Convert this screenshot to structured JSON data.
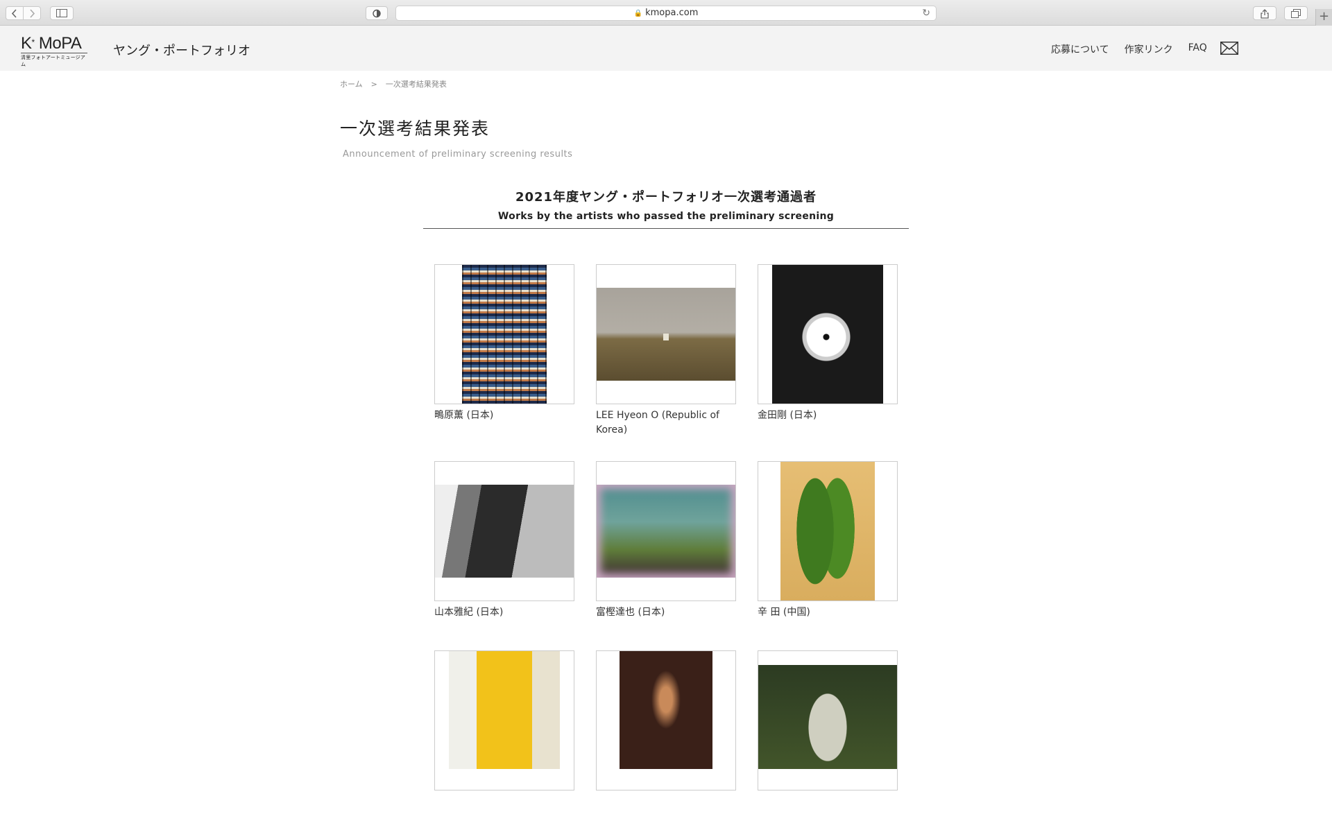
{
  "browser": {
    "url": "kmopa.com"
  },
  "header": {
    "logo_main": "K",
    "logo_sup": "*",
    "logo_rest": "MoPA",
    "logo_sub": "清里フォトアートミュージアム",
    "site_title": "ヤング・ポートフォリオ",
    "nav": [
      "応募について",
      "作家リンク",
      "FAQ"
    ]
  },
  "breadcrumb": {
    "home": "ホーム",
    "separator": ">",
    "current": "一次選考結果発表"
  },
  "page": {
    "title": "一次選考結果発表",
    "subtitle": "Announcement of preliminary screening results"
  },
  "section": {
    "title": "2021年度ヤング・ポートフォリオ一次選考通過者",
    "subtitle": "Works by the artists who passed the preliminary screening"
  },
  "works": [
    {
      "artist": "鴫原薫 (日本)"
    },
    {
      "artist": "LEE Hyeon O (Republic of Korea)"
    },
    {
      "artist": "金田剛 (日本)"
    },
    {
      "artist": "山本雅紀 (日本)"
    },
    {
      "artist": "富樫達也 (日本)"
    },
    {
      "artist": "辛 田 (中国)"
    }
  ]
}
